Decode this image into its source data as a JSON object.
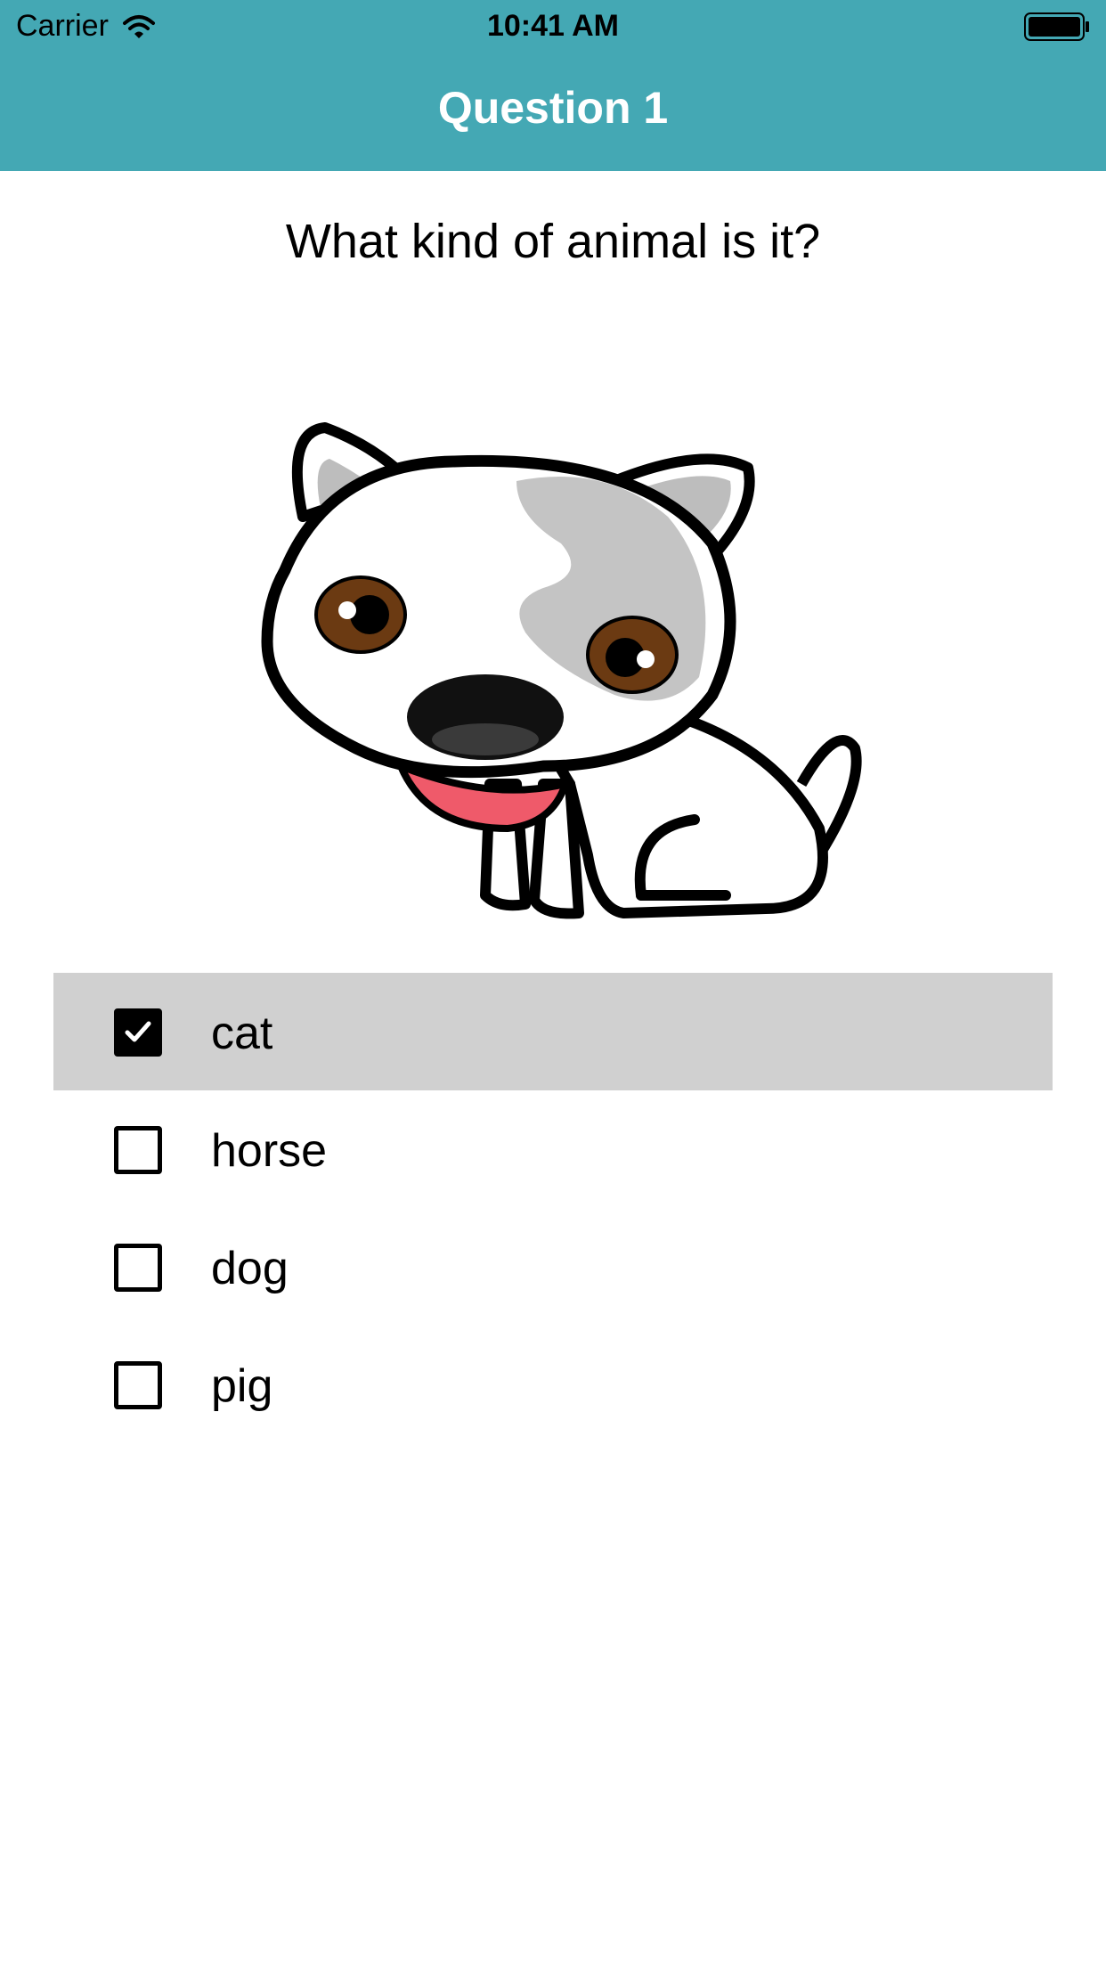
{
  "status_bar": {
    "carrier": "Carrier",
    "time": "10:41 AM",
    "icons": [
      "wifi-icon",
      "battery-icon"
    ]
  },
  "nav": {
    "title": "Question 1",
    "color": "#44a8b4"
  },
  "question": {
    "text": "What kind of animal is it?",
    "image": "puppy-illustration"
  },
  "options": [
    {
      "label": "cat",
      "checked": true
    },
    {
      "label": "horse",
      "checked": false
    },
    {
      "label": "dog",
      "checked": false
    },
    {
      "label": "pig",
      "checked": false
    }
  ],
  "colors": {
    "selected_row": "#d0d0d0",
    "accent": "#44a8b4"
  }
}
